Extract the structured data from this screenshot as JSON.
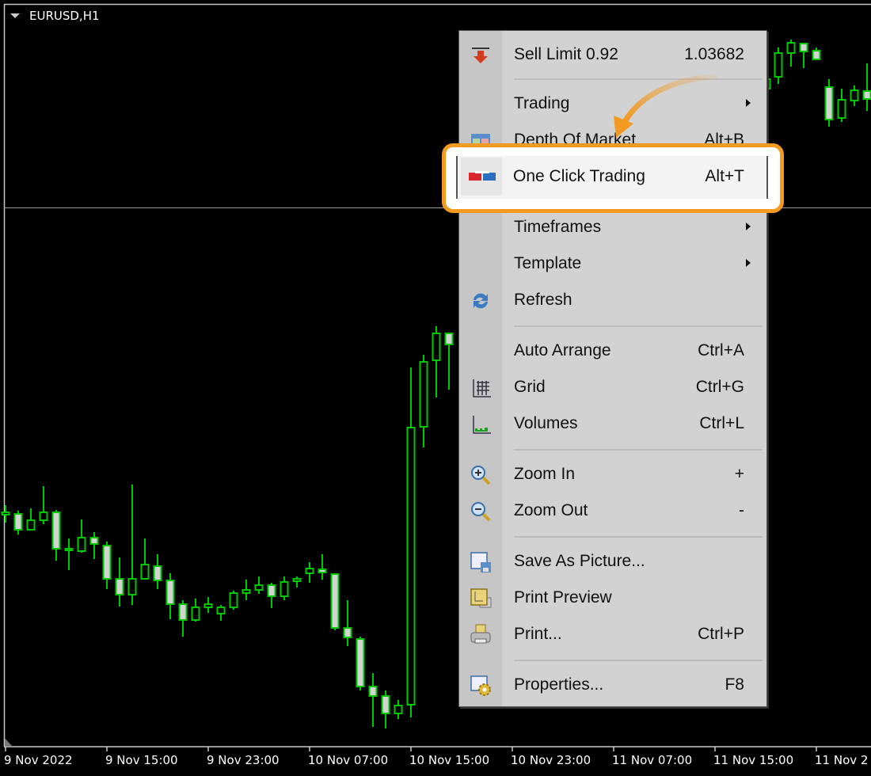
{
  "chart": {
    "symbol": "EURUSD,H1",
    "bull_color": "#00c800",
    "bear_fill": "#d3d3d3",
    "time_axis": [
      "9 Nov 2022",
      "9 Nov 15:00",
      "9 Nov 23:00",
      "10 Nov 07:00",
      "10 Nov 15:00",
      "10 Nov 23:00",
      "11 Nov 07:00",
      "11 Nov 15:00",
      "11 Nov 2"
    ]
  },
  "menu": {
    "sell_limit": {
      "label": "Sell Limit 0.92",
      "value": "1.03682",
      "icon": "sell-limit-arrow-icon"
    },
    "items": [
      {
        "label": "Trading",
        "shortcut": "",
        "submenu": true,
        "icon": ""
      },
      {
        "label": "Depth Of Market",
        "shortcut": "Alt+B",
        "submenu": false,
        "icon": "depth-of-market-icon"
      },
      {
        "label": "One Click Trading",
        "shortcut": "Alt+T",
        "submenu": false,
        "icon": "one-click-trading-icon",
        "highlighted": true
      },
      {
        "label": "Timeframes",
        "shortcut": "",
        "submenu": true,
        "icon": ""
      },
      {
        "label": "Template",
        "shortcut": "",
        "submenu": true,
        "icon": ""
      },
      {
        "label": "Refresh",
        "shortcut": "",
        "submenu": false,
        "icon": "refresh-icon"
      },
      {
        "label": "Auto Arrange",
        "shortcut": "Ctrl+A",
        "submenu": false,
        "icon": ""
      },
      {
        "label": "Grid",
        "shortcut": "Ctrl+G",
        "submenu": false,
        "icon": "grid-icon"
      },
      {
        "label": "Volumes",
        "shortcut": "Ctrl+L",
        "submenu": false,
        "icon": "volumes-icon"
      },
      {
        "label": "Zoom In",
        "shortcut": "+",
        "submenu": false,
        "icon": "zoom-in-icon"
      },
      {
        "label": "Zoom Out",
        "shortcut": "-",
        "submenu": false,
        "icon": "zoom-out-icon"
      },
      {
        "label": "Save As Picture...",
        "shortcut": "",
        "submenu": false,
        "icon": "save-picture-icon"
      },
      {
        "label": "Print Preview",
        "shortcut": "",
        "submenu": false,
        "icon": "print-preview-icon"
      },
      {
        "label": "Print...",
        "shortcut": "Ctrl+P",
        "submenu": false,
        "icon": "print-icon"
      },
      {
        "label": "Properties...",
        "shortcut": "F8",
        "submenu": false,
        "icon": "properties-icon"
      }
    ]
  },
  "highlight_color": "#f29a21"
}
